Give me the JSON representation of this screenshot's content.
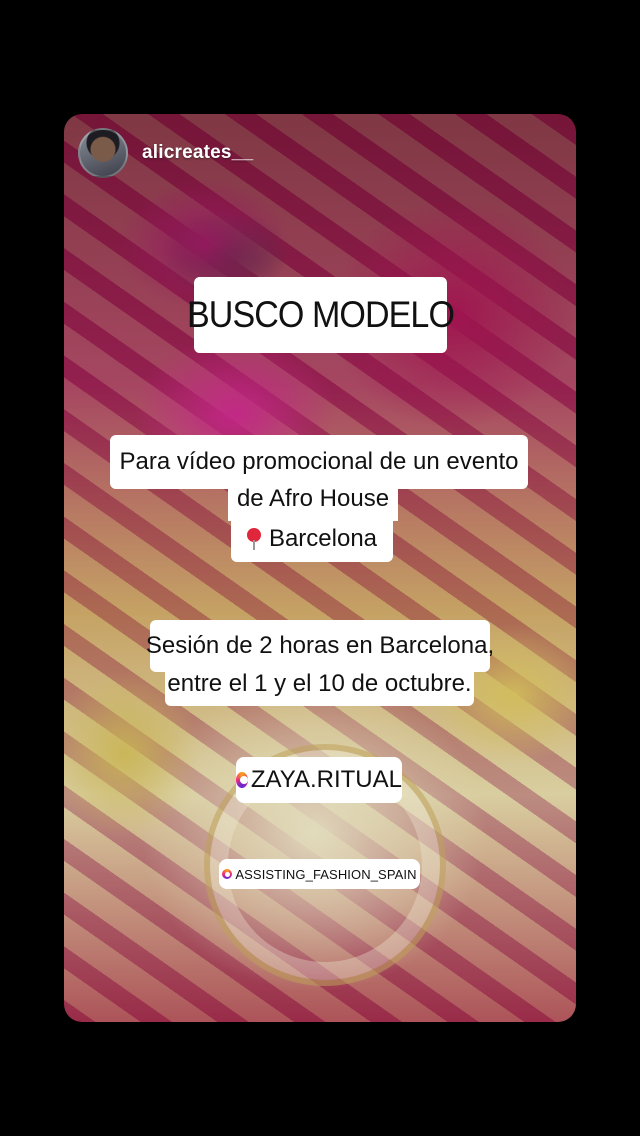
{
  "story": {
    "username": "alicreates__",
    "title": "BUSCO MODELO",
    "promo": {
      "line1": "Para vídeo promocional de un evento",
      "line2": "de Afro House",
      "location": "Barcelona"
    },
    "session": {
      "line1": "Sesión de 2 horas en Barcelona,",
      "line2": "entre el 1 y el 10 de octubre."
    },
    "mentions": [
      {
        "handle": "ZAYA.RITUAL",
        "icon": "threads-icon"
      },
      {
        "handle": "ASSISTING_FASHION_SPAIN",
        "icon": "threads-icon"
      }
    ]
  },
  "colors": {
    "background": "#000000",
    "label_background": "#ffffff",
    "label_text": "#111111",
    "pin": "#e0263a"
  }
}
